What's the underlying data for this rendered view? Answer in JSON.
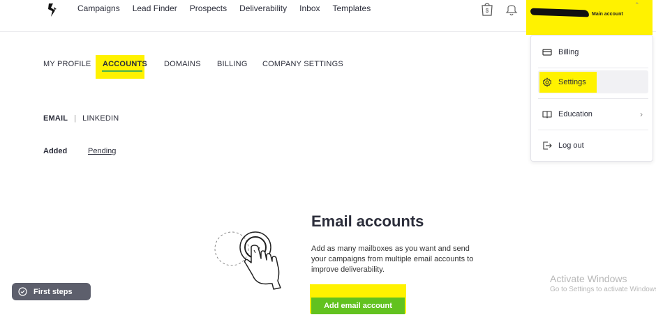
{
  "nav": {
    "items": [
      "Campaigns",
      "Lead Finder",
      "Prospects",
      "Deliverability",
      "Inbox",
      "Templates"
    ]
  },
  "account": {
    "role": "Main account"
  },
  "settings_tabs": {
    "items": [
      "MY PROFILE",
      "ACCOUNTS",
      "DOMAINS",
      "BILLING",
      "COMPANY SETTINGS"
    ],
    "active": "ACCOUNTS"
  },
  "subtabs": {
    "email": "EMAIL",
    "separator": "|",
    "linkedin": "LINKEDIN"
  },
  "filters": {
    "added": "Added",
    "pending": "Pending"
  },
  "empty_state": {
    "title": "Email accounts",
    "description": "Add as many mailboxes as you want and send your campaigns from multiple email accounts to improve deliverability.",
    "button": "Add email account"
  },
  "first_steps": {
    "label": "First steps"
  },
  "dropdown": {
    "items": [
      "Billing",
      "Settings",
      "Education",
      "Log out"
    ]
  },
  "watermark": {
    "title": "Activate Windows",
    "subtitle": "Go to Settings to activate Windows."
  },
  "colors": {
    "highlight": "#fff200",
    "accent_green": "#62c21f",
    "underline_green": "#4db34d",
    "text_dark": "#2b2d3a",
    "pill_gray": "#5d5f6c"
  }
}
